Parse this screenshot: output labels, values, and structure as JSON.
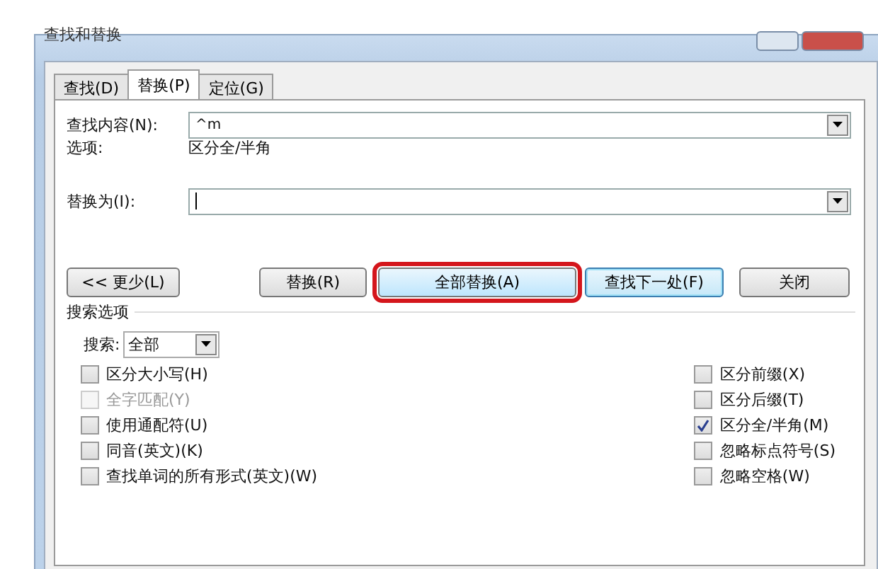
{
  "window": {
    "title": "查找和替换"
  },
  "tabs": [
    {
      "label": "查找(D)",
      "selected": false
    },
    {
      "label": "替换(P)",
      "selected": true
    },
    {
      "label": "定位(G)",
      "selected": false
    }
  ],
  "find": {
    "label": "查找内容(N):",
    "value": "^m",
    "options_label": "选项:",
    "options_value": "区分全/半角"
  },
  "replace": {
    "label": "替换为(I):",
    "focused": true
  },
  "buttons": [
    {
      "label": "<< 更少(L)",
      "highlighted": false,
      "focused": false
    },
    {
      "label": "替换(R)",
      "highlighted": false,
      "focused": false
    },
    {
      "label": "全部替换(A)",
      "highlighted": true,
      "focused": false
    },
    {
      "label": "查找下一处(F)",
      "highlighted": false,
      "focused": true
    },
    {
      "label": "关闭",
      "highlighted": false,
      "focused": false
    }
  ],
  "search_options": {
    "title": "搜索选项",
    "search_label": "搜索:",
    "search_value": "全部"
  },
  "left_options": [
    {
      "label": "区分大小写(H)",
      "checked": false,
      "disabled": false
    },
    {
      "label": "全字匹配(Y)",
      "checked": false,
      "disabled": true
    },
    {
      "label": "使用通配符(U)",
      "checked": false,
      "disabled": false
    },
    {
      "label": "同音(英文)(K)",
      "checked": false,
      "disabled": false
    },
    {
      "label": "查找单词的所有形式(英文)(W)",
      "checked": false,
      "disabled": false
    }
  ],
  "right_options": [
    {
      "label": "区分前缀(X)",
      "checked": false,
      "disabled": false
    },
    {
      "label": "区分后缀(T)",
      "checked": false,
      "disabled": false
    },
    {
      "label": "区分全/半角(M)",
      "checked": true,
      "disabled": false
    },
    {
      "label": "忽略标点符号(S)",
      "checked": false,
      "disabled": false
    },
    {
      "label": "忽略空格(W)",
      "checked": false,
      "disabled": false
    }
  ]
}
